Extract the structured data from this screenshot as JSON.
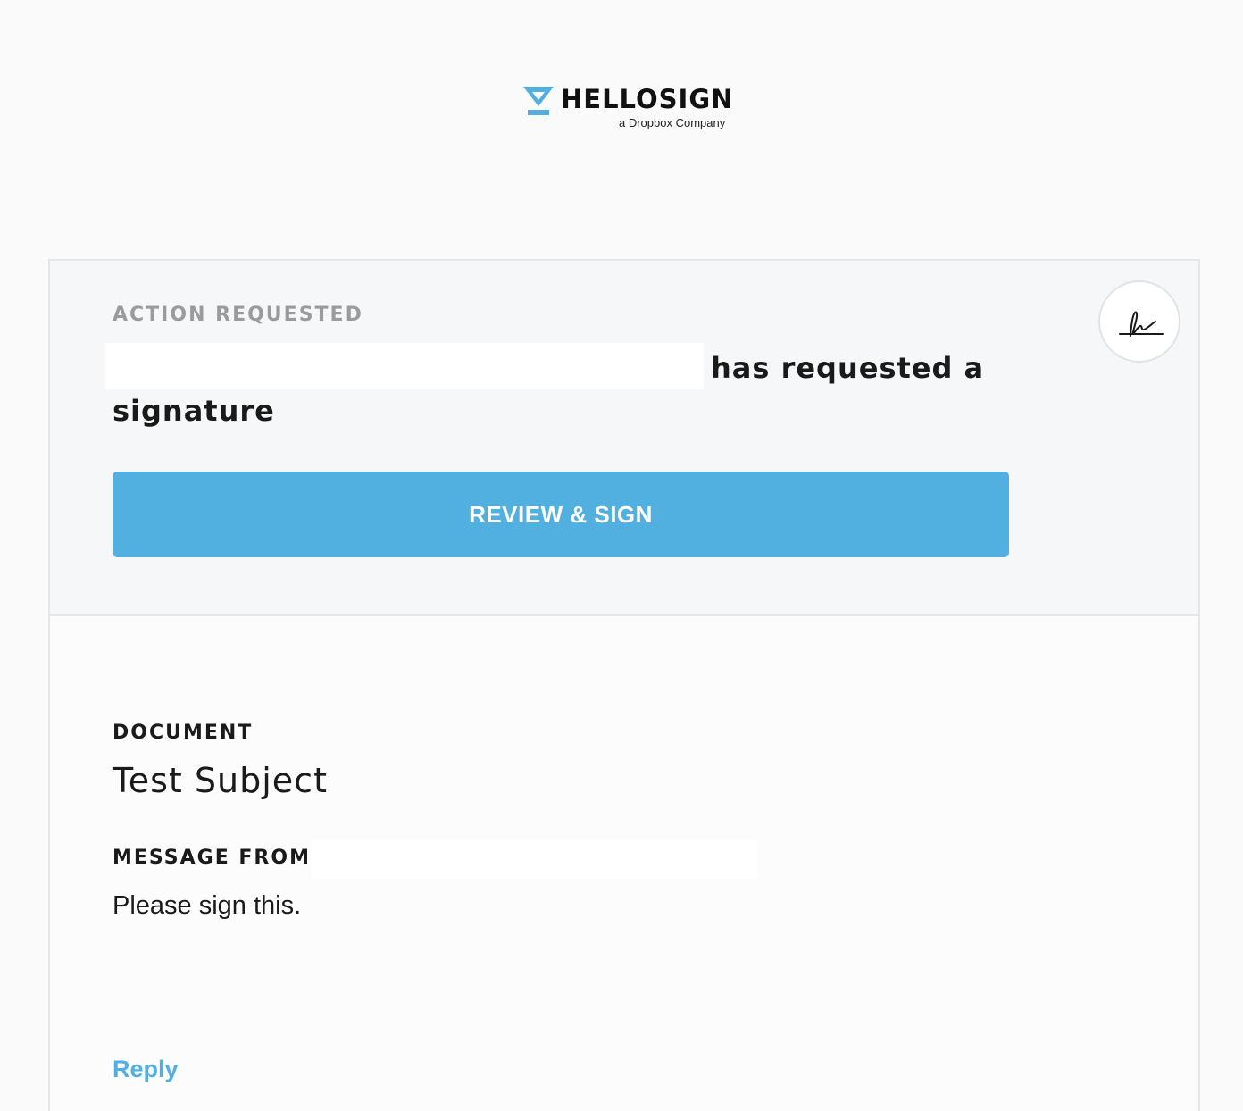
{
  "brand": {
    "name": "HELLOSIGN",
    "tagline": "a Dropbox Company",
    "accent_color": "#52b0e0",
    "logo_icon": "hellosign-logo-icon"
  },
  "action": {
    "eyebrow": "ACTION REQUESTED",
    "headline": "has requested a signature",
    "sender_redacted": true,
    "icon": "signature-icon"
  },
  "cta": {
    "label": "REVIEW & SIGN"
  },
  "document": {
    "label": "DOCUMENT",
    "title": "Test Subject"
  },
  "message": {
    "label": "MESSAGE FROM",
    "body": "Please sign this."
  },
  "footer": {
    "reply_label": "Reply"
  }
}
